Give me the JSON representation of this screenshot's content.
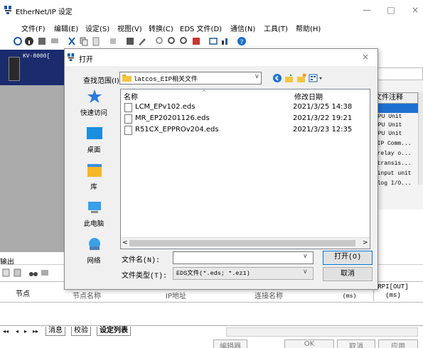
{
  "window": {
    "title": "EtherNet/IP 设定",
    "controls": {
      "minimize": "—",
      "maximize": "□",
      "close": "×"
    }
  },
  "menu": [
    "文件(F)",
    "编辑(E)",
    "设定(S)",
    "视图(V)",
    "转换(C)",
    "EDS 文件(D)",
    "通信(N)",
    "工具(T)",
    "帮助(H)"
  ],
  "device": {
    "label": "KV-8000["
  },
  "background_table": {
    "column_header": "文件注释",
    "cells": [
      "CPU Unit",
      "CPU Unit",
      "CPU Unit",
      "t/IP Comm...",
      "t relay o...",
      "t transis...",
      "t input unit",
      "nalog I/O..."
    ]
  },
  "output": {
    "label": "输出",
    "columns": {
      "node": "节点",
      "node_name": "节点名称",
      "ip": "IP地址",
      "connection": "连接名称",
      "rpi_out": "RPI[OUT]",
      "rpi_unit": "(ms)"
    }
  },
  "bottom_tabs": [
    "消息",
    "校验",
    "设定列表"
  ],
  "bottom_buttons": [
    "编辑器",
    "OK",
    "取消",
    "应用"
  ],
  "dialog": {
    "title": "打开",
    "close": "×",
    "look_in_label": "查找范围(I):",
    "look_in_value": "latcos_EIP相关文件",
    "places": [
      {
        "label": "快速访问",
        "icon": "star-icon"
      },
      {
        "label": "桌面",
        "icon": "desktop-icon"
      },
      {
        "label": "库",
        "icon": "library-icon"
      },
      {
        "label": "此电脑",
        "icon": "computer-icon"
      },
      {
        "label": "网络",
        "icon": "network-icon"
      }
    ],
    "columns": {
      "name": "名称",
      "modified": "修改日期"
    },
    "files": [
      {
        "name": "LCM_EPv102.eds",
        "date": "2021/3/25 14:38"
      },
      {
        "name": "MR_EP20201126.eds",
        "date": "2021/3/22 19:21"
      },
      {
        "name": "R51CX_EPPROv204.eds",
        "date": "2021/3/23 12:35"
      }
    ],
    "file_name_label": "文件名(N):",
    "file_name_value": "",
    "file_type_label": "文件类型(T):",
    "file_type_value": "EDS文件(*.eds; *.ez1)",
    "open_button": "打开(O)",
    "cancel_button": "取消"
  }
}
